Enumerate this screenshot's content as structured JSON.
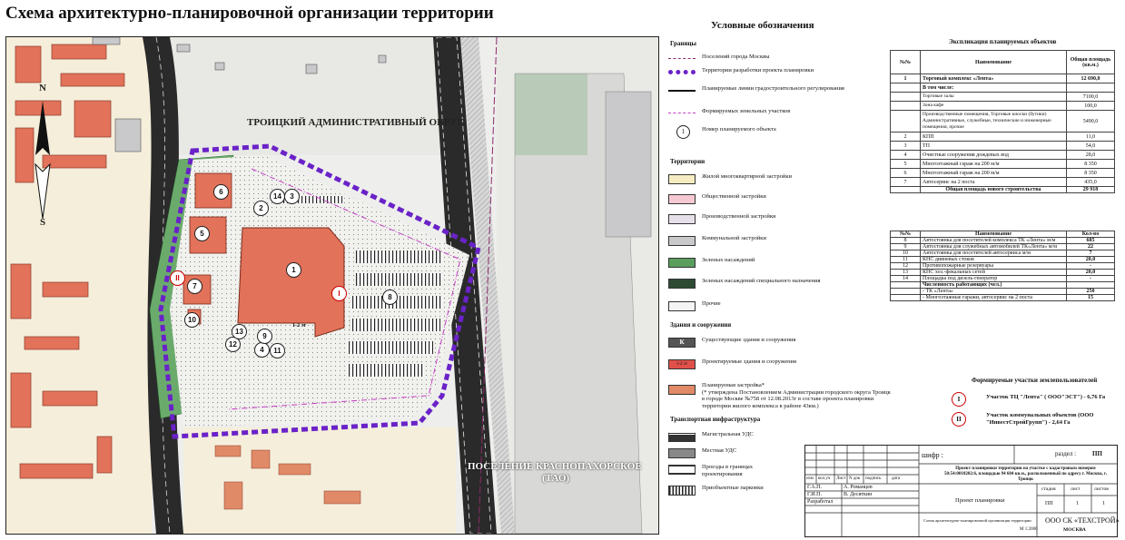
{
  "title": "Схема архитектурно-планировочной организации территории",
  "map": {
    "district_label": "ТРОИЦКИЙ АДМИНИСТРАТИВНЫЙ ОКРУГ",
    "settlement_label_line1": "ПОСЕЛЕНИЕ КРАСНОПАХОРСКОЕ",
    "settlement_label_line2": "(ТАО)",
    "compass_n": "N",
    "compass_s": "S",
    "hall_label": "1-2 эт",
    "object_numbers": [
      "1",
      "2",
      "3",
      "4",
      "5",
      "6",
      "7",
      "8",
      "9",
      "10",
      "11",
      "12",
      "13",
      "14"
    ],
    "parcel_i": "I",
    "parcel_ii": "II"
  },
  "legend": {
    "title": "Условные обозначения",
    "sec_borders": "Границы",
    "borders": [
      {
        "label": "Поселений города Москвы",
        "color": "#8a2a6a"
      },
      {
        "label": "Территории разработки проекта планировки",
        "color": "#6a22c8"
      },
      {
        "label": "Планируемые линии градостроительного регулирования",
        "color": "#111111"
      },
      {
        "label": "Формируемых земельных участков",
        "color": "#c43cc4"
      },
      {
        "label": "Номер планируемого объекта"
      }
    ],
    "number_sample": "1",
    "sec_territories": "Территории",
    "territories": [
      {
        "label": "Жилой многоквартирной застройки",
        "color": "#f6ecc2"
      },
      {
        "label": "Общественной застройки",
        "color": "#f6c9d2"
      },
      {
        "label": "Производственной застройки",
        "color": "#e6e0ea"
      },
      {
        "label": "Коммунальной застройки",
        "color": "#c9c9cc"
      },
      {
        "label": "Зеленых насаждений",
        "color": "#5a9e5e"
      },
      {
        "label": "Зеленых насаждений специального назначения",
        "color": "#2e4a33"
      },
      {
        "label": "Прочие",
        "color": "#f4f4f4"
      }
    ],
    "sec_buildings": "Здания и сооружения",
    "buildings": [
      {
        "label": "Существующие здания и сооружения",
        "sample": "К",
        "color": "#555555"
      },
      {
        "label": "Проектируемые здания и сооружения",
        "sample": "1-2 эт",
        "color": "#e0504a"
      },
      {
        "label": "Планируемая застройка*",
        "note": "(* утверждена Постановлением Администрации городского округа Троицк в городе Москве №758 от 12.08.2013г в составе проекта планировки территории жилого комплекса в районе 43км.)",
        "color": "#e08a68"
      }
    ],
    "sec_transport": "Транспортная инфраструктура",
    "transport": [
      {
        "label": "Магистральная УДС"
      },
      {
        "label": "Местная УДС"
      },
      {
        "label": "Проезды в границах проектирования"
      },
      {
        "label": "Приобъектные парковки"
      }
    ]
  },
  "table1": {
    "title": "Экспликация планируемых объектов",
    "headers": [
      "№№",
      "Наименование",
      "Общая площадь (кв.м.)"
    ],
    "rows": [
      {
        "n": "1",
        "name": "Торговый комплекс «Лента»",
        "val": "12 690,0",
        "bold": true
      },
      {
        "n": "",
        "name": "В том числе:",
        "val": "",
        "bold": true
      },
      {
        "n": "",
        "name": "Торговые залы",
        "val": "7100,0"
      },
      {
        "n": "",
        "name": "Зона кафе",
        "val": "100,0"
      },
      {
        "n": "",
        "name": "Производственные помещения, Торговые киоски (бутики) Административные, служебные, технические и инженерные помещения, прочие",
        "val": "5490,0"
      },
      {
        "n": "2",
        "name": "КПП",
        "val": "11,0"
      },
      {
        "n": "3",
        "name": "ТП",
        "val": "54,0"
      },
      {
        "n": "4",
        "name": "Очистные сооружения дождевых вод",
        "val": "28,0"
      },
      {
        "n": "5",
        "name": "Многоэтажный гараж на 200 м/м",
        "val": "8 350"
      },
      {
        "n": "6",
        "name": "Многоэтажный гараж на 200 м/м",
        "val": "8 350"
      },
      {
        "n": "7",
        "name": "Автосервис на 2 поста",
        "val": "435,0"
      }
    ],
    "total_label": "Общая площадь нового строительства",
    "total_value": "29 918"
  },
  "table2": {
    "headers": [
      "№№",
      "Наименование",
      "Кол-во"
    ],
    "rows": [
      {
        "n": "8",
        "name": "Автостоянка для посетителей комплекса ТК «Лента» м/м",
        "val": "685"
      },
      {
        "n": "9",
        "name": "Автостоянка для служебных автомобилей ТК«Лента» м/м",
        "val": "22"
      },
      {
        "n": "10",
        "name": "Автостоянка для посетителей автосервиса м/м",
        "val": "7"
      },
      {
        "n": "11",
        "name": "КНС дивневых стоков",
        "val": "20,0"
      },
      {
        "n": "12",
        "name": "Противопожарные резервуары",
        "val": "-"
      },
      {
        "n": "13",
        "name": "КНС хоз.-фекальных сетей",
        "val": "20,0"
      },
      {
        "n": "14",
        "name": "Площадка под дизель-генератор",
        "val": "-"
      }
    ],
    "workers_label": "Численность работающих (чел.)",
    "workers": [
      {
        "name": "- ТК «Лента»",
        "val": "250"
      },
      {
        "name": "- Многоэтажные гаражи, автосервис на 2 поста",
        "val": "15"
      }
    ]
  },
  "land": {
    "title": "Формируемые участки землепользователей",
    "items": [
      {
        "num": "I",
        "label": "Участок ТЦ \"Лента\" ( ООО\"ЭСТ\") - 6,76 Га"
      },
      {
        "num": "II",
        "label": "Участок коммунальных объектов (ООО \"ИнвестСтройГрупп\") - 2,64 Га"
      }
    ]
  },
  "stamp": {
    "cipher_label": "шифр :",
    "section_label": "раздел :",
    "section_value": "ПП",
    "project_desc": "Проект планировки территории на участке с кадастровым номером 50:54:0010202:6, площадью 94 684 кв.м., расположенный по адресу г. Москва, г. Троицк",
    "cols": [
      "изм",
      "кол.уч",
      "Лист",
      "N док",
      "подпись",
      "дата"
    ],
    "gap_label": "Г.А.П.",
    "gap_name": "А. Романцев",
    "gip_label": "Г.И.П.",
    "gip_name": "В. Десяткин",
    "developed": "Разработал",
    "stage_project": "Проект планировки",
    "stage_h": "стадия",
    "sheet_h": "лист",
    "sheets_h": "листов",
    "stage_v": "ПП",
    "sheet_v": "1",
    "sheets_v": "1",
    "drawing_name": "Схема архитектурно-планировочной организации территории",
    "scale": "М 1:2000",
    "company": "ООО СК «ТЕХСТРОЙ»",
    "city": "МОСКВА"
  }
}
